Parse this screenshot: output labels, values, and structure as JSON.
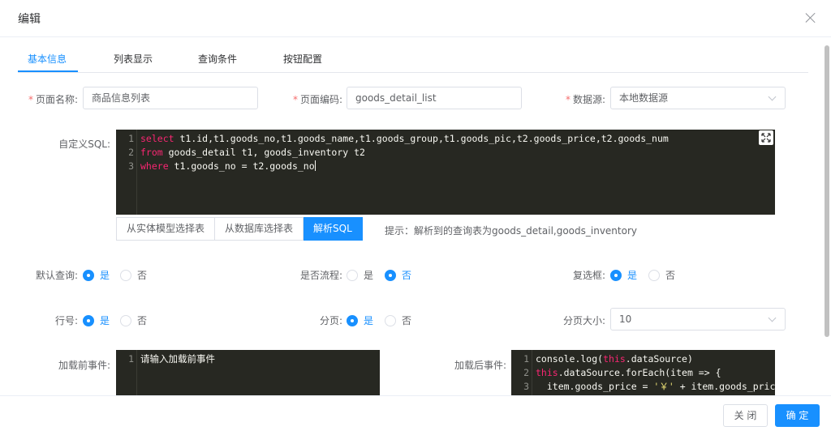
{
  "dialog": {
    "title": "编辑"
  },
  "tabs": [
    "基本信息",
    "列表显示",
    "查询条件",
    "按钮配置"
  ],
  "form": {
    "page_name": {
      "label": "页面名称:",
      "value": "商品信息列表"
    },
    "page_code": {
      "label": "页面编码:",
      "value": "goods_detail_list"
    },
    "datasource": {
      "label": "数据源:",
      "value": "本地数据源"
    },
    "sql": {
      "label": "自定义SQL:",
      "lines": [
        {
          "n": "1",
          "kw": "select",
          "rest": " t1.id,t1.goods_no,t1.goods_name,t1.goods_group,t1.goods_pic,t2.goods_price,t2.goods_num"
        },
        {
          "n": "2",
          "kw": "from",
          "rest": " goods_detail t1, goods_inventory t2"
        },
        {
          "n": "3",
          "kw": "where",
          "rest": " t1.goods_no = t2.goods_no"
        }
      ],
      "buttons": [
        "从实体模型选择表",
        "从数据库选择表",
        "解析SQL"
      ],
      "hint": "提示：解析到的查询表为goods_detail,goods_inventory"
    },
    "radios": {
      "yes": "是",
      "no": "否",
      "default_query": {
        "label": "默认查询:",
        "selected": "yes"
      },
      "is_flow": {
        "label": "是否流程:",
        "selected": "no"
      },
      "checkbox": {
        "label": "复选框:",
        "selected": "yes"
      },
      "row_number": {
        "label": "行号:",
        "selected": "yes"
      },
      "paging": {
        "label": "分页:",
        "selected": "yes"
      }
    },
    "page_size": {
      "label": "分页大小:",
      "value": "10"
    },
    "before_load": {
      "label": "加载前事件:",
      "line_no": "1",
      "placeholder": "请输入加载前事件"
    },
    "after_load": {
      "label": "加载后事件:",
      "lines": [
        {
          "n": "1",
          "a": "console.log(",
          "kw": "this",
          "b": ".dataSource)"
        },
        {
          "n": "2",
          "kw": "this",
          "b": ".dataSource.forEach(item => {"
        },
        {
          "n": "3",
          "a": "  item.goods_price = ",
          "str": "'￥'",
          "b": " + item.goods_price"
        }
      ]
    }
  },
  "footer": {
    "cancel": "关 闭",
    "ok": "确 定"
  },
  "colors": {
    "primary": "#1890ff",
    "editor_bg": "#272822",
    "required": "#f56c6c"
  }
}
